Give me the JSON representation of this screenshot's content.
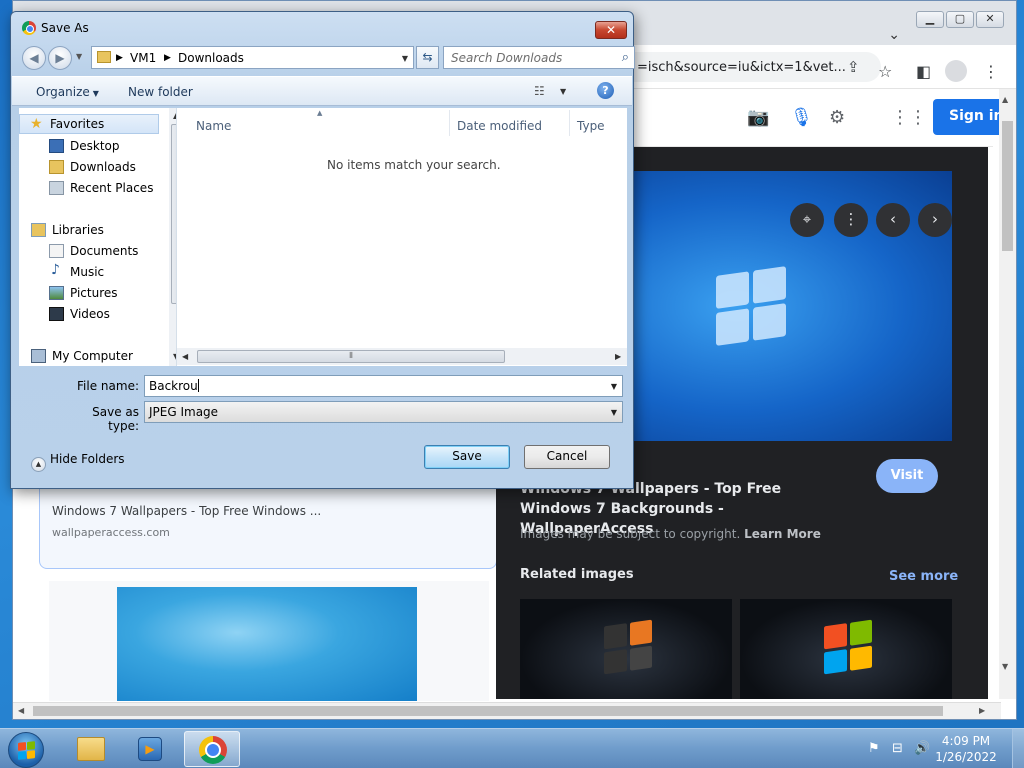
{
  "browser": {
    "window_controls": [
      "▁",
      "▢",
      "✕"
    ],
    "tab_menu_icon": "chevron-down",
    "url": "=isch&source=iu&ictx=1&vet...",
    "signin_label": "Sign in",
    "results": {
      "card_title": "Windows 7 Wallpapers - Top Free Windows ...",
      "card_source": "wallpaperaccess.com"
    },
    "preview": {
      "visit_label": "Visit",
      "title": "Windows 7 Wallpapers - Top Free Windows 7 Backgrounds - WallpaperAccess",
      "copyright_text": "Images may be subject to copyright.",
      "learn_more": "Learn More",
      "related_label": "Related images",
      "see_more": "See more"
    }
  },
  "dialog": {
    "title": "Save As",
    "close_label": "✕",
    "breadcrumb": [
      "VM1",
      "Downloads"
    ],
    "search_placeholder": "Search Downloads",
    "toolbar": {
      "organize": "Organize",
      "new_folder": "New folder",
      "help": "?"
    },
    "nav_pane": {
      "favorites": "Favorites",
      "desktop": "Desktop",
      "downloads": "Downloads",
      "recent_places": "Recent Places",
      "libraries": "Libraries",
      "documents": "Documents",
      "music": "Music",
      "pictures": "Pictures",
      "videos": "Videos",
      "my_computer": "My Computer"
    },
    "columns": [
      "Name",
      "Date modified",
      "Type"
    ],
    "empty_message": "No items match your search.",
    "file_name_label": "File name:",
    "file_name_value": "Backrou",
    "save_as_type_label": "Save as type:",
    "save_as_type_value": "JPEG Image",
    "hide_folders": "Hide Folders",
    "save_button": "Save",
    "cancel_button": "Cancel"
  },
  "taskbar": {
    "time": "4:09 PM",
    "date": "1/26/2022"
  },
  "colors": {
    "chrome_blue": "#1a73e8",
    "preview_bg": "#202124",
    "dialog_frame": "#b9d1ea",
    "taskbar": "#6f9ccb"
  }
}
